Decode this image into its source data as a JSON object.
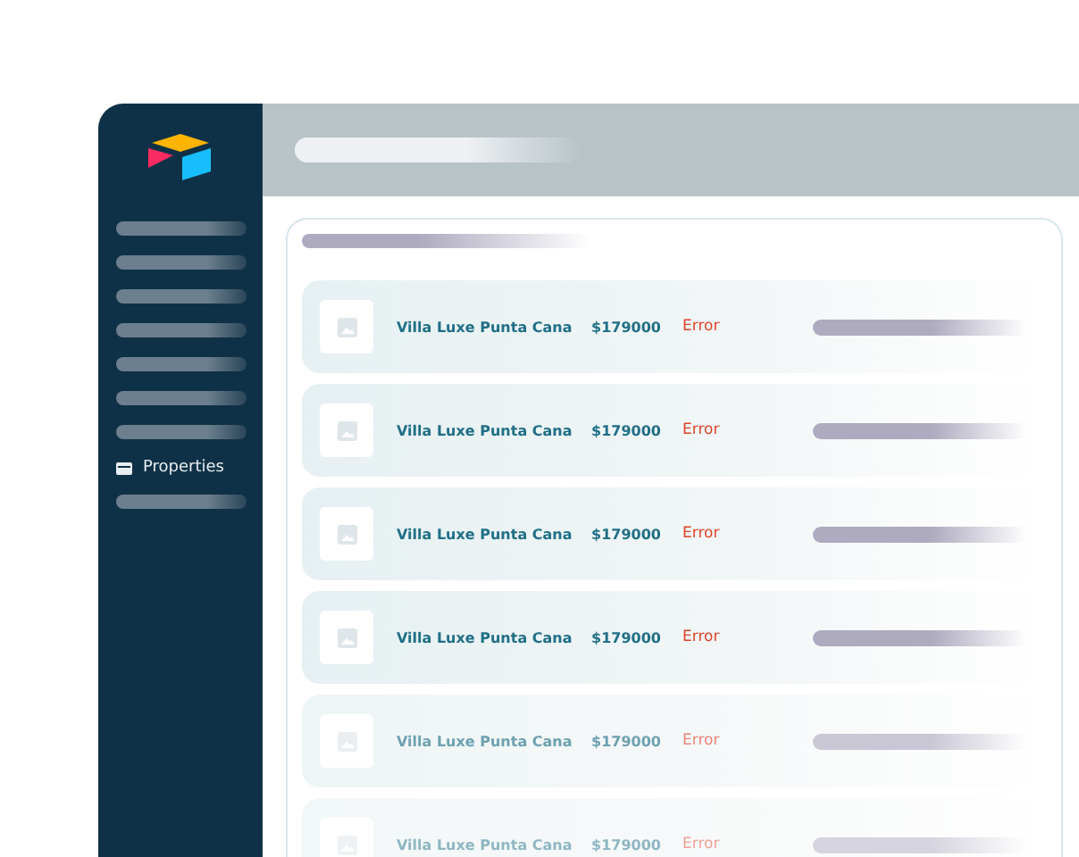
{
  "sidebar": {
    "items": [
      {
        "kind": "placeholder"
      },
      {
        "kind": "placeholder"
      },
      {
        "kind": "placeholder"
      },
      {
        "kind": "placeholder"
      },
      {
        "kind": "placeholder"
      },
      {
        "kind": "placeholder"
      },
      {
        "kind": "placeholder"
      },
      {
        "kind": "link",
        "label": "Properties"
      },
      {
        "kind": "placeholder"
      }
    ]
  },
  "listings": [
    {
      "name": "Villa Luxe Punta Cana",
      "price": "$179000",
      "status": "Error",
      "faded": false
    },
    {
      "name": "Villa Luxe Punta Cana",
      "price": "$179000",
      "status": "Error",
      "faded": false
    },
    {
      "name": "Villa Luxe Punta Cana",
      "price": "$179000",
      "status": "Error",
      "faded": false
    },
    {
      "name": "Villa Luxe Punta Cana",
      "price": "$179000",
      "status": "Error",
      "faded": false
    },
    {
      "name": "Villa Luxe Punta Cana",
      "price": "$179000",
      "status": "Error",
      "faded": true
    },
    {
      "name": "Villa Luxe Punta Cana",
      "price": "$179000",
      "status": "Error",
      "faded": true
    }
  ]
}
